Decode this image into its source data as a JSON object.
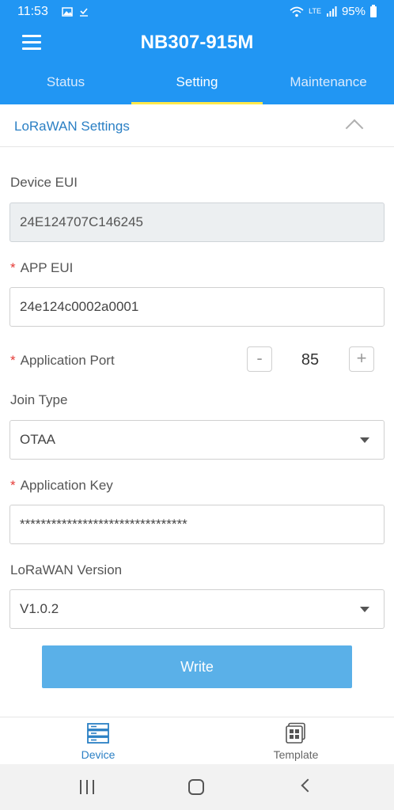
{
  "status_bar": {
    "time": "11:53",
    "battery": "95%",
    "network": "LTE"
  },
  "app": {
    "title": "NB307-915M"
  },
  "tabs": [
    {
      "label": "Status"
    },
    {
      "label": "Setting"
    },
    {
      "label": "Maintenance"
    }
  ],
  "active_tab": "Setting",
  "section": {
    "title": "LoRaWAN Settings"
  },
  "form": {
    "device_eui_label": "Device EUI",
    "device_eui_value": "24E124707C146245",
    "app_eui_label": "APP EUI",
    "app_eui_value": "24e124c0002a0001",
    "app_port_label": "Application Port",
    "app_port_value": "85",
    "minus": "-",
    "plus": "+",
    "join_type_label": "Join Type",
    "join_type_value": "OTAA",
    "app_key_label": "Application Key",
    "app_key_value": "********************************",
    "version_label": "LoRaWAN Version",
    "version_value": "V1.0.2",
    "required_marker": "*"
  },
  "write_button": "Write",
  "bottom_nav": [
    {
      "label": "Device",
      "icon": "server-icon"
    },
    {
      "label": "Template",
      "icon": "template-icon"
    }
  ],
  "colors": {
    "primary": "#2196f3",
    "tab_indicator": "#ffe94a",
    "accent_text": "#2a7fc4",
    "button": "#5ab0e8",
    "required": "#e53935"
  }
}
